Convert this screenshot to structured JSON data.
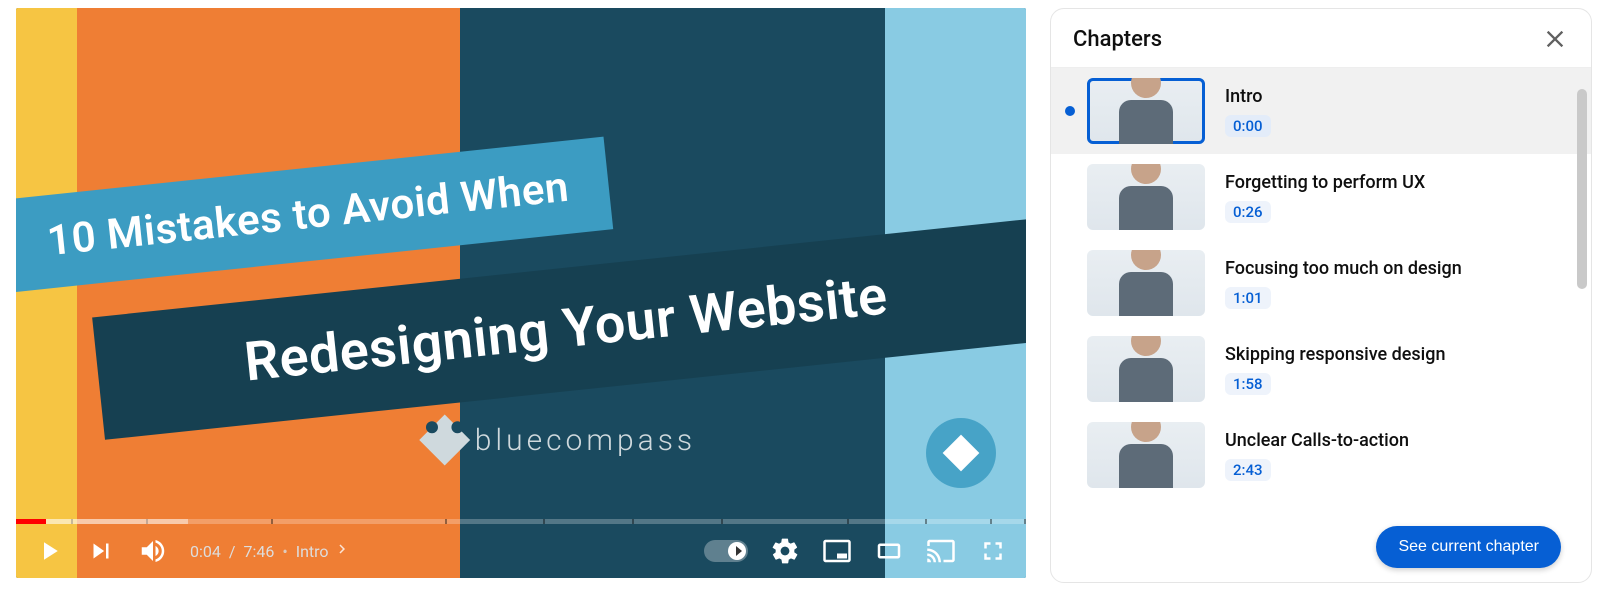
{
  "video": {
    "title_line1": "10 Mistakes to Avoid When",
    "title_line2": "Redesigning Your Website",
    "brand": "bluecompass",
    "current_time": "0:04",
    "duration": "7:46",
    "separator": "/",
    "chapter_indicator": "•",
    "current_chapter": "Intro",
    "progress_percent": 3,
    "segments_pct": [
      5.6,
      7.5,
      12.3,
      17.3,
      9.7,
      8.8,
      8.8,
      12.5,
      7.7,
      6.4,
      3.4
    ]
  },
  "panel": {
    "heading": "Chapters",
    "see_current": "See current chapter",
    "chapters": [
      {
        "title": "Intro",
        "time": "0:00",
        "active": true
      },
      {
        "title": "Forgetting to perform UX",
        "time": "0:26",
        "active": false
      },
      {
        "title": "Focusing too much on design",
        "time": "1:01",
        "active": false
      },
      {
        "title": "Skipping responsive design",
        "time": "1:58",
        "active": false
      },
      {
        "title": "Unclear Calls-to-action",
        "time": "2:43",
        "active": false
      }
    ]
  }
}
